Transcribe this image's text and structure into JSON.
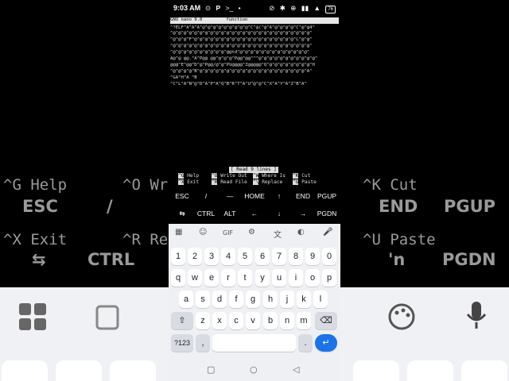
{
  "status": {
    "time": "9:03 AM",
    "left_icons": [
      "⊙",
      "P",
      ">_",
      "•"
    ],
    "right_icons": [
      "⊘",
      "✱",
      "⊕",
      "▮▮",
      "▲"
    ],
    "battery": "76"
  },
  "nano": {
    "title_left": "GNU nano 9.0",
    "title_center": "function",
    "lines": [
      "^?ELF^A^A^A^@^@^@^@^@^@^@^@^@^C^@(^@^A^@^@^@^@^C^@^@4^",
      "^@^@^@^@^@^@^@^@^@^@^@^@^@^@^@^@^@^@^@^@^@^@^@^@^@^@^",
      "^@^@^@^F^@^@^@^@^@^@^@^@^@^@^@^@^@^@^@^@^@^@^@^L^@^@^",
      "^@^@^@^@^@^@^@^@^@^@^@^@^@^@^@^@^@^@^@^@^@^@^@^@^@^@^",
      "^@^@^@^@^@^@^@^@^@^@^@@td^@^@^@^@^@^@^@^@^@^@^@^@^@^",
      "A@^@ @@.^A^P@@ @@^@^@^@^P@@^@@^^^@^@^@^@^@^@^@^@^@^@^@^",
      "@@@^E^@@^D^@^P@@/@^@^PU@@@@^Z@@@@@^Q^@^@^@^@^@^@^@^@^H",
      "^@^@^@^@^B^@^@^@^@^@^@^@^@^@^@^@^@^@^@^@^@^@^@^@^@^A^",
      "^GA^H^A ^B",
      "^C^L^A^N^@^D^A^P^A^Q^B^R^T^A^U^@^@^C^X^A^Y^A^Z^B^A^"
    ],
    "status_msg": "[ Read 9 lines ]",
    "shortcuts": [
      {
        "key": "^G",
        "label": "Help"
      },
      {
        "key": "^X",
        "label": "Exit"
      },
      {
        "key": "^O",
        "label": "Write Out"
      },
      {
        "key": "^R",
        "label": "Read File"
      },
      {
        "key": "^W",
        "label": "Where Is"
      },
      {
        "key": "^\\",
        "label": "Replace"
      },
      {
        "key": "^K",
        "label": "Cut"
      },
      {
        "key": "^U",
        "label": "Paste"
      }
    ]
  },
  "extra_keys": {
    "row1": [
      "ESC",
      "/",
      "—",
      "HOME",
      "↑",
      "END",
      "PGUP"
    ],
    "row2": [
      "⇆",
      "CTRL",
      "ALT",
      "←",
      "↓",
      "→",
      "PGDN"
    ]
  },
  "keyboard": {
    "toolbar": [
      "▦",
      "☺",
      "GIF",
      "⚙",
      "文",
      "◐",
      "🎤"
    ],
    "numbers": [
      "1",
      "2",
      "3",
      "4",
      "5",
      "6",
      "7",
      "8",
      "9",
      "0"
    ],
    "row_q": [
      "q",
      "w",
      "e",
      "r",
      "t",
      "y",
      "u",
      "i",
      "o",
      "p"
    ],
    "row_a": [
      "a",
      "s",
      "d",
      "f",
      "g",
      "h",
      "j",
      "k",
      "l"
    ],
    "row_z": [
      "z",
      "x",
      "c",
      "v",
      "b",
      "n",
      "m"
    ],
    "shift": "⇧",
    "backspace": "⌫",
    "sym": "?123",
    "comma": ",",
    "period": ".",
    "enter": "↵",
    "nav": [
      "▢",
      "○",
      "◁"
    ]
  },
  "background": {
    "help_left": [
      "^G Help",
      "^X Exit"
    ],
    "help_mid": [
      "^O Wr",
      "^R Re"
    ],
    "help_right": [
      "^K Cut",
      "^U Paste"
    ],
    "row1": [
      "ESC",
      "/",
      "END",
      "PGUP"
    ],
    "row2": [
      "⇆",
      "CTRL",
      "'n",
      "PGDN"
    ]
  }
}
